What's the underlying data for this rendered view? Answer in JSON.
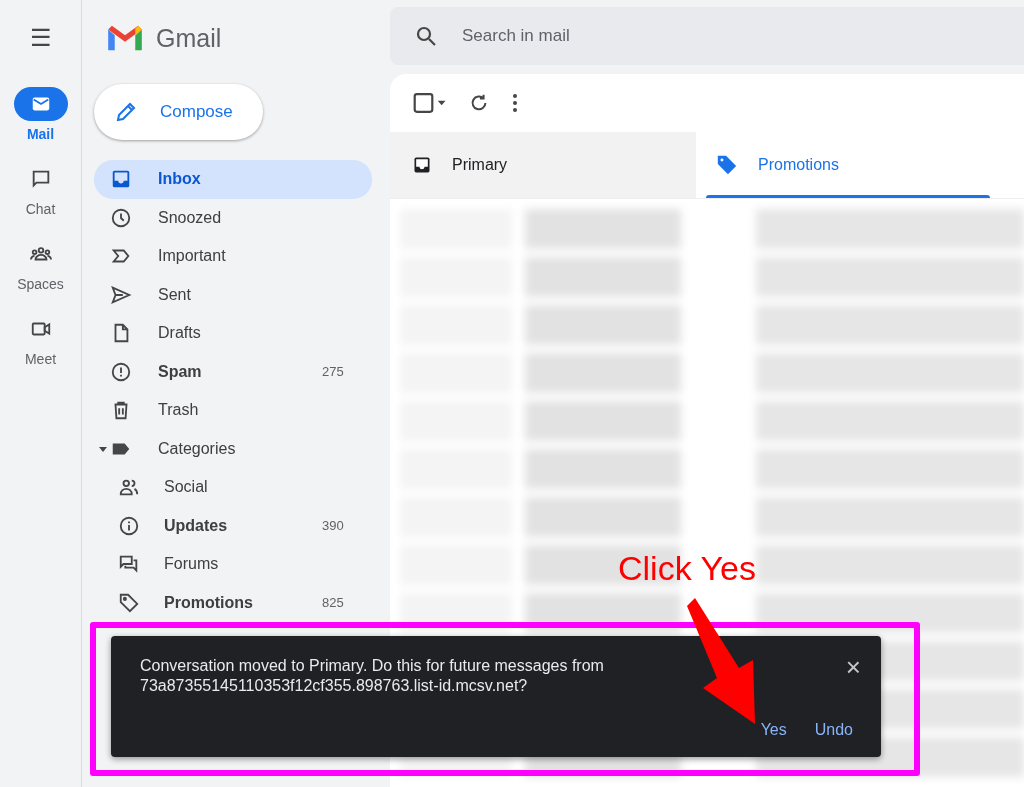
{
  "rail": {
    "menu_icon": "☰",
    "items": [
      {
        "label": "Mail",
        "selected": true
      },
      {
        "label": "Chat",
        "selected": false
      },
      {
        "label": "Spaces",
        "selected": false
      },
      {
        "label": "Meet",
        "selected": false
      }
    ]
  },
  "brand": {
    "name": "Gmail"
  },
  "compose": {
    "label": "Compose"
  },
  "sidebar": {
    "items": [
      {
        "label": "Inbox",
        "selected": true,
        "unread": true
      },
      {
        "label": "Snoozed",
        "selected": false,
        "unread": false
      },
      {
        "label": "Important",
        "selected": false,
        "unread": false
      },
      {
        "label": "Sent",
        "selected": false,
        "unread": false
      },
      {
        "label": "Drafts",
        "selected": false,
        "unread": false
      },
      {
        "label": "Spam",
        "selected": false,
        "unread": true,
        "count": "275"
      },
      {
        "label": "Trash",
        "selected": false,
        "unread": false
      },
      {
        "label": "Categories",
        "selected": false,
        "unread": false,
        "expanded": true,
        "children": [
          {
            "label": "Social",
            "selected": false,
            "unread": false
          },
          {
            "label": "Updates",
            "selected": false,
            "unread": true,
            "count": "390"
          },
          {
            "label": "Forums",
            "selected": false,
            "unread": false
          },
          {
            "label": "Promotions",
            "selected": false,
            "unread": true,
            "count": "825"
          }
        ]
      }
    ]
  },
  "search": {
    "placeholder": "Search in mail"
  },
  "select_all": {
    "checked": false
  },
  "tabs": [
    {
      "label": "Primary",
      "selected": false
    },
    {
      "label": "Promotions",
      "selected": true
    }
  ],
  "toast": {
    "message": "Conversation moved to Primary. Do this for future messages from 73a87355145110353f12cf355.898763.list-id.mcsv.net?",
    "close": "×",
    "actions": [
      "Yes",
      "Undo"
    ]
  },
  "annotation": {
    "text": "Click Yes"
  }
}
